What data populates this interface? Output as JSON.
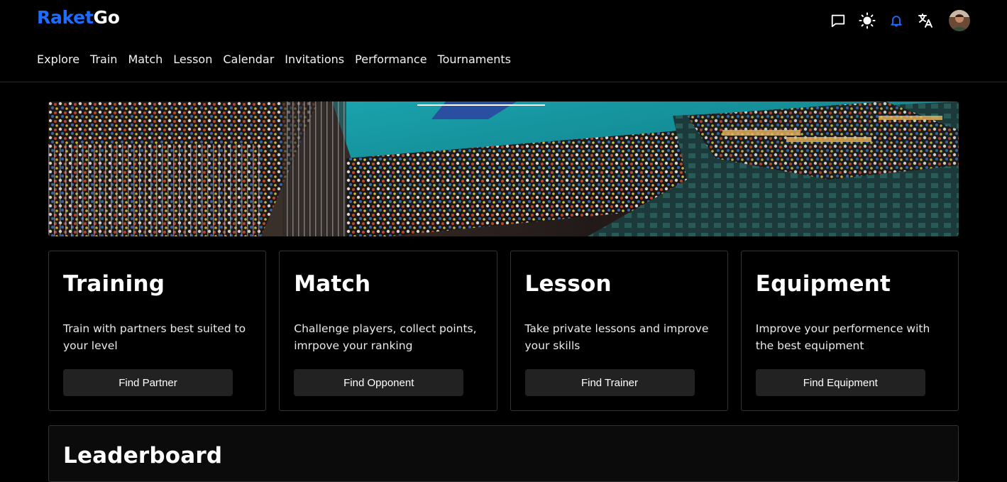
{
  "header": {
    "logo_part1": "Raket",
    "logo_part2": "Go",
    "icons": [
      "chat-icon",
      "sun-icon",
      "bell-icon",
      "translate-icon",
      "avatar"
    ],
    "accent_color": "#1d6dff"
  },
  "nav": {
    "items": [
      "Explore",
      "Train",
      "Match",
      "Lesson",
      "Calendar",
      "Invitations",
      "Performance",
      "Tournaments"
    ]
  },
  "cards": [
    {
      "title": "Training",
      "description": "Train with partners best suited to your level",
      "button": "Find Partner"
    },
    {
      "title": "Match",
      "description": "Challenge players, collect points, imrpove your ranking",
      "button": "Find Opponent"
    },
    {
      "title": "Lesson",
      "description": "Take private lessons and improve your skills",
      "button": "Find Trainer"
    },
    {
      "title": "Equipment",
      "description": "Improve your performence with the best equipment",
      "button": "Find Equipment"
    }
  ],
  "leaderboard": {
    "title": "Leaderboard"
  }
}
